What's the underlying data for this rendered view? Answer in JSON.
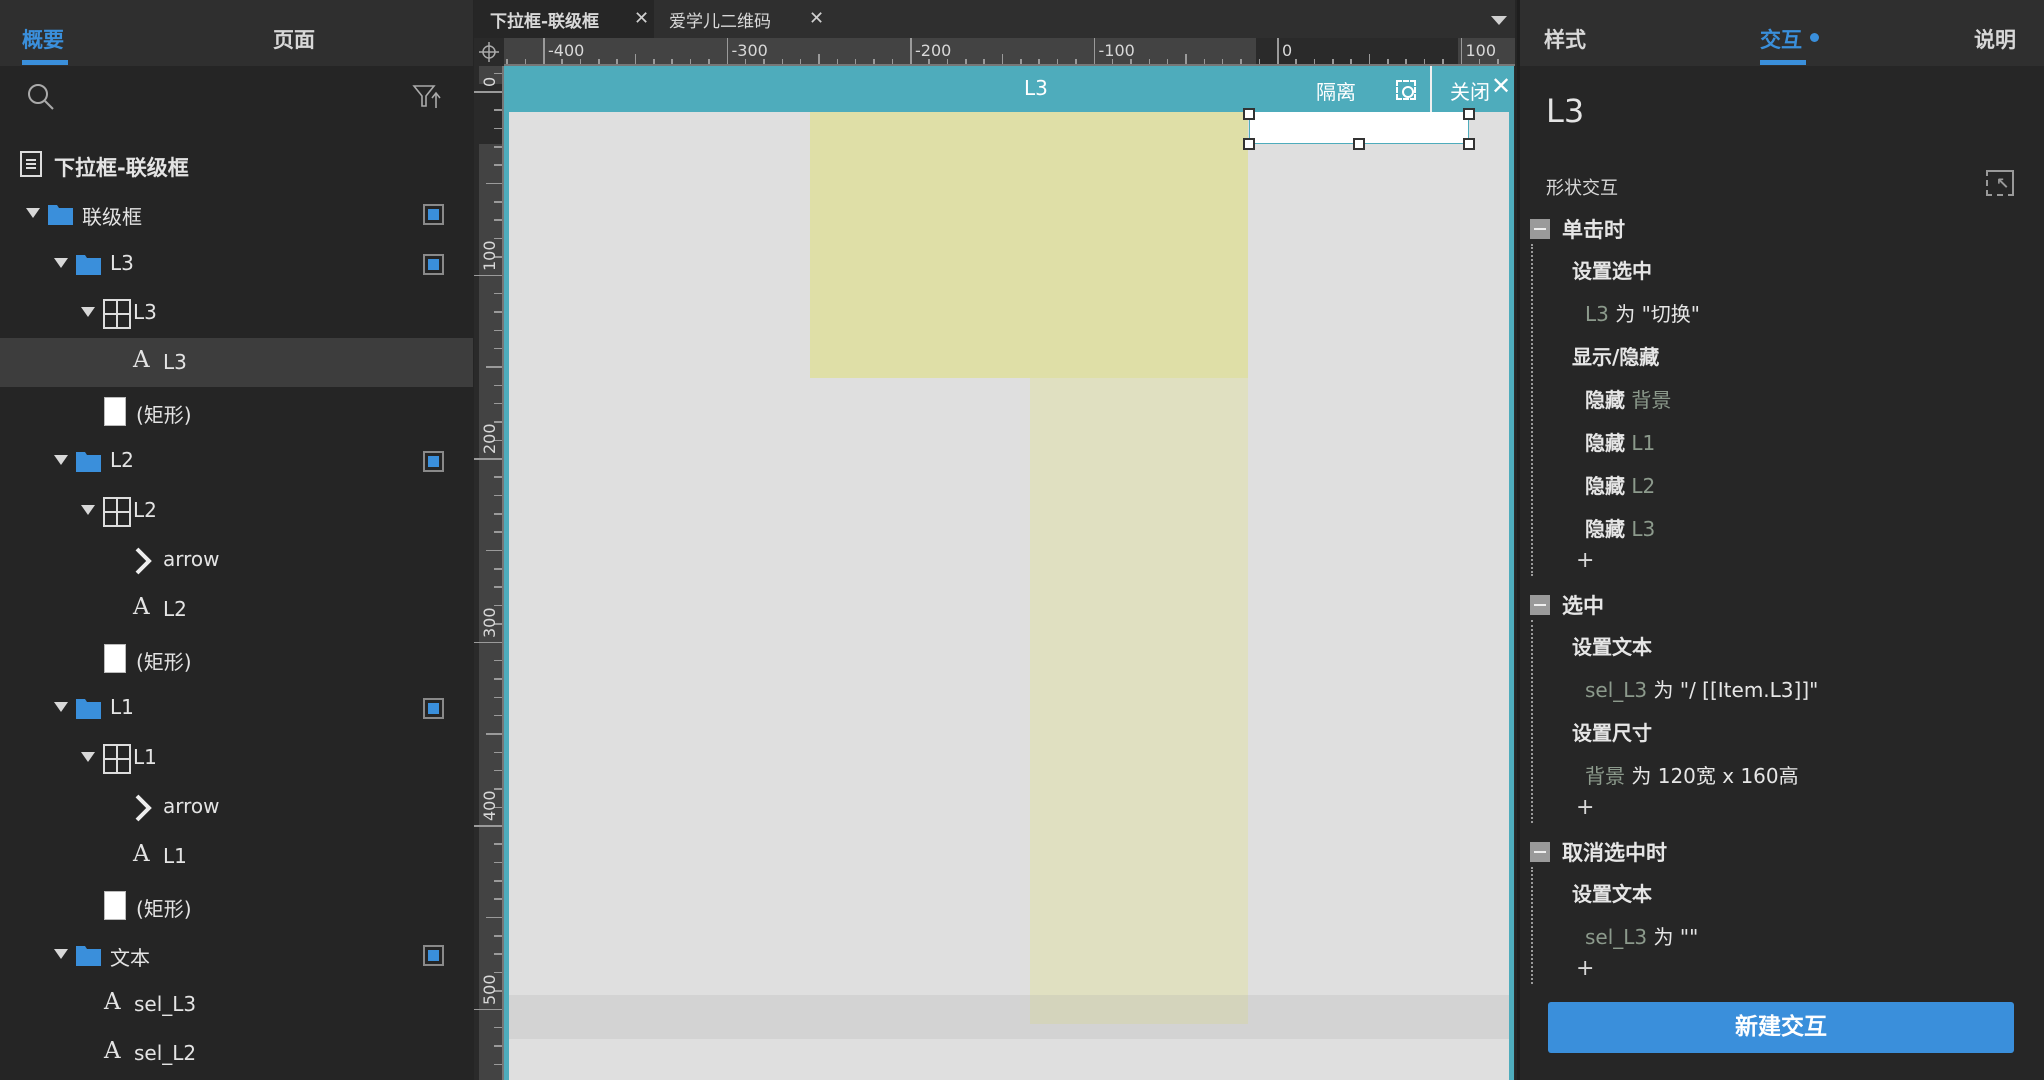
{
  "left_panel": {
    "tabs": [
      {
        "label": "概要",
        "active": true
      },
      {
        "label": "页面",
        "active": false
      }
    ],
    "icons": {
      "search": "search-icon",
      "filter": "filter-sort-icon"
    },
    "tree": [
      {
        "label": "下拉框-联级框",
        "type": "page",
        "depth": 0
      },
      {
        "label": "联级框",
        "type": "folder",
        "depth": 1,
        "expanded": true,
        "visible_toggle": true
      },
      {
        "label": "L3",
        "type": "folder",
        "depth": 2,
        "expanded": true,
        "visible_toggle": true
      },
      {
        "label": "L3",
        "type": "repeater",
        "depth": 3,
        "expanded": true
      },
      {
        "label": "L3",
        "type": "text",
        "depth": 4,
        "selected": true
      },
      {
        "label": "(矩形)",
        "type": "rectangle",
        "depth": 3
      },
      {
        "label": "L2",
        "type": "folder",
        "depth": 2,
        "expanded": true,
        "visible_toggle": true
      },
      {
        "label": "L2",
        "type": "repeater",
        "depth": 3,
        "expanded": true
      },
      {
        "label": "arrow",
        "type": "arrow",
        "depth": 4
      },
      {
        "label": "L2",
        "type": "text",
        "depth": 4
      },
      {
        "label": "(矩形)",
        "type": "rectangle",
        "depth": 3
      },
      {
        "label": "L1",
        "type": "folder",
        "depth": 2,
        "expanded": true,
        "visible_toggle": true
      },
      {
        "label": "L1",
        "type": "repeater",
        "depth": 3,
        "expanded": true
      },
      {
        "label": "arrow",
        "type": "arrow",
        "depth": 4
      },
      {
        "label": "L1",
        "type": "text",
        "depth": 4
      },
      {
        "label": "(矩形)",
        "type": "rectangle",
        "depth": 3
      },
      {
        "label": "文本",
        "type": "folder",
        "depth": 2,
        "expanded": true,
        "visible_toggle": true
      },
      {
        "label": "sel_L3",
        "type": "text",
        "depth": 3
      },
      {
        "label": "sel_L2",
        "type": "text",
        "depth": 3
      }
    ]
  },
  "center": {
    "doc_tabs": [
      {
        "label": "下拉框-联级框",
        "active": true
      },
      {
        "label": "爱学儿二维码",
        "active": false
      }
    ],
    "ruler": {
      "h_labels": [
        "-400",
        "-300",
        "-200",
        "-100",
        "0",
        "100"
      ],
      "v_labels": [
        "0",
        "100",
        "200",
        "300",
        "400",
        "500"
      ]
    },
    "canvas_header": {
      "title": "L3",
      "isolate_label": "隔离",
      "close_label": "关闭"
    }
  },
  "right_panel": {
    "tabs": [
      {
        "label": "样式",
        "active": false
      },
      {
        "label": "交互",
        "active": true,
        "has_dot": true
      },
      {
        "label": "说明",
        "active": false
      }
    ],
    "widget_name": "L3",
    "section_label": "形状交互",
    "events": [
      {
        "name": "单击时",
        "actions": [
          {
            "name": "设置选中",
            "params": [
              {
                "target": "L3",
                "text": "为 \"切换\""
              }
            ]
          },
          {
            "name": "显示/隐藏",
            "params": [
              {
                "verb": "隐藏",
                "target": "背景"
              },
              {
                "verb": "隐藏",
                "target": "L1"
              },
              {
                "verb": "隐藏",
                "target": "L2"
              },
              {
                "verb": "隐藏",
                "target": "L3"
              }
            ]
          }
        ]
      },
      {
        "name": "选中",
        "actions": [
          {
            "name": "设置文本",
            "params": [
              {
                "target": "sel_L3",
                "text": "为 \"/ [[Item.L3]]\""
              }
            ]
          },
          {
            "name": "设置尺寸",
            "params": [
              {
                "target": "背景",
                "text": "为 120宽 x 160高"
              }
            ]
          }
        ]
      },
      {
        "name": "取消选中时",
        "actions": [
          {
            "name": "设置文本",
            "params": [
              {
                "target": "sel_L3",
                "text": "为 \"\""
              }
            ]
          }
        ]
      }
    ],
    "add_symbol": "+",
    "new_interaction_label": "新建交互"
  },
  "colors": {
    "accent": "#3a8fdb",
    "canvas_header": "#4eacbc",
    "highlight_yellow": "#dfdfa7"
  }
}
